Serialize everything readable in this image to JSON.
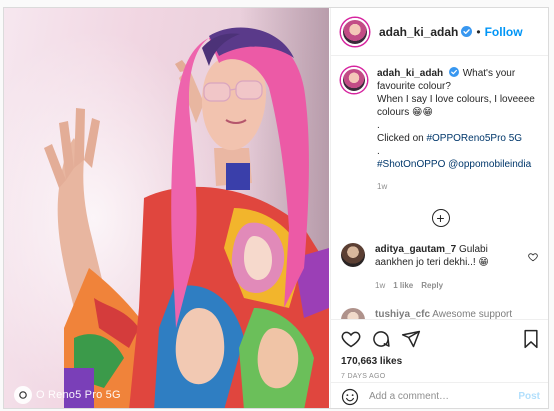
{
  "post": {
    "username": "adah_ki_adah",
    "follow_label": "Follow",
    "dot": "•",
    "more_label": "···",
    "watermark_text": "O Reno5 Pro 5G"
  },
  "caption": {
    "username": "adah_ki_adah",
    "line1": "What's your favourite colour?",
    "line2": "When I say I love colours, I loveeee colours 😁😁",
    "sep1": ".",
    "line3_prefix": "Clicked on ",
    "line3_tag": "#OPPOReno5Pro 5G",
    "sep2": ".",
    "line4_tag": "#ShotOnOPPO",
    "line4_mention": "@oppomobileindia",
    "age": "1w"
  },
  "load_more": "+",
  "comments": [
    {
      "username": "aditya_gautam_7",
      "text": "Gulabi aankhen jo teri dekhi..! 😁",
      "age": "1w",
      "likes": "1 like",
      "reply": "Reply"
    },
    {
      "username": "tushiya_cfc",
      "text": "Awesome support me"
    }
  ],
  "stats": {
    "likes": "170,663 likes",
    "posted": "7 DAYS AGO"
  },
  "composer": {
    "placeholder": "Add a comment…",
    "post_label": "Post"
  },
  "icons": {
    "heart": "heart-icon",
    "comment": "comment-icon",
    "share": "share-icon",
    "save": "bookmark-icon",
    "emoji": "emoji-icon",
    "verified": "verified-badge-icon"
  },
  "colors": {
    "accent_blue": "#0095f6",
    "verified_blue": "#3897f0",
    "muted": "#8e8e8e",
    "text": "#262626",
    "post_disabled": "#b2dffc"
  }
}
